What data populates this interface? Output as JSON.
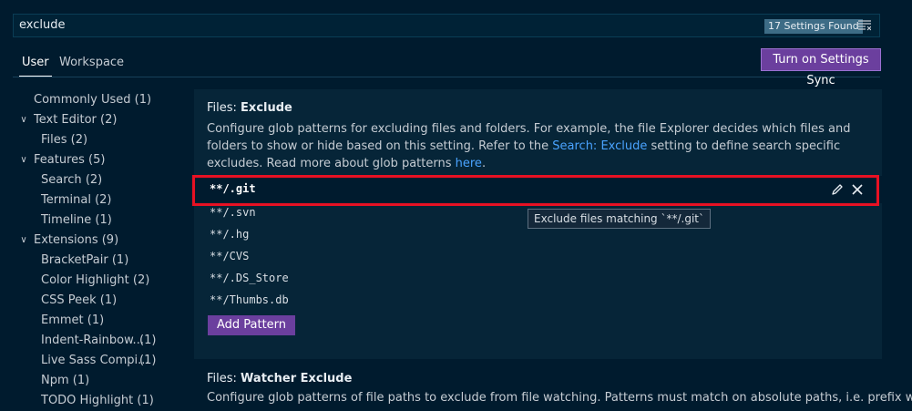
{
  "search": {
    "value": "exclude",
    "results_badge": "17 Settings Found"
  },
  "tabs": [
    {
      "label": "User",
      "active": true
    },
    {
      "label": "Workspace",
      "active": false
    }
  ],
  "sync_button": "Turn on Settings Sync",
  "toc": [
    {
      "label": "Commonly Used",
      "count": "(1)",
      "level": 0,
      "expandable": false
    },
    {
      "label": "Text Editor",
      "count": "(2)",
      "level": 0,
      "expandable": true
    },
    {
      "label": "Files",
      "count": "(2)",
      "level": 1,
      "expandable": false
    },
    {
      "label": "Features",
      "count": "(5)",
      "level": 0,
      "expandable": true
    },
    {
      "label": "Search",
      "count": "(2)",
      "level": 1,
      "expandable": false
    },
    {
      "label": "Terminal",
      "count": "(2)",
      "level": 1,
      "expandable": false
    },
    {
      "label": "Timeline",
      "count": "(1)",
      "level": 1,
      "expandable": false
    },
    {
      "label": "Extensions",
      "count": "(9)",
      "level": 0,
      "expandable": true
    },
    {
      "label": "BracketPair",
      "count": "(1)",
      "level": 1,
      "expandable": false
    },
    {
      "label": "Color Highlight",
      "count": "(2)",
      "level": 1,
      "expandable": false
    },
    {
      "label": "CSS Peek",
      "count": "(1)",
      "level": 1,
      "expandable": false
    },
    {
      "label": "Emmet",
      "count": "(1)",
      "level": 1,
      "expandable": false
    },
    {
      "label": "Indent-Rainbow...",
      "count": "(1)",
      "level": 1,
      "expandable": false
    },
    {
      "label": "Live Sass Compi...",
      "count": "(1)",
      "level": 1,
      "expandable": false
    },
    {
      "label": "Npm",
      "count": "(1)",
      "level": 1,
      "expandable": false
    },
    {
      "label": "TODO Highlight",
      "count": "(1)",
      "level": 1,
      "expandable": false
    }
  ],
  "setting_files_exclude": {
    "category": "Files: ",
    "name": "Exclude",
    "desc_part1": "Configure glob patterns for excluding files and folders. For example, the file Explorer decides which files and folders to show or hide based on this setting. Refer to the ",
    "desc_link1": "Search: Exclude",
    "desc_part2": " setting to define search specific excludes. Read more about glob patterns ",
    "desc_link2": "here",
    "desc_part3": ".",
    "patterns": [
      "**/.git",
      "**/.svn",
      "**/.hg",
      "**/CVS",
      "**/.DS_Store",
      "**/Thumbs.db"
    ],
    "tooltip": "Exclude files matching `**/.git`",
    "add_button": "Add Pattern"
  },
  "setting_watcher_exclude": {
    "category": "Files: ",
    "name": "Watcher Exclude",
    "desc_part1": "Configure glob patterns of file paths to exclude from file watching. Patterns must match on absolute paths, i.e. prefix with ",
    "desc_accent": "**/"
  },
  "colors": {
    "background": "#001b2e",
    "accent_purple": "#6b3f9e",
    "link": "#4aa3ff",
    "highlight_red": "#e81123"
  }
}
